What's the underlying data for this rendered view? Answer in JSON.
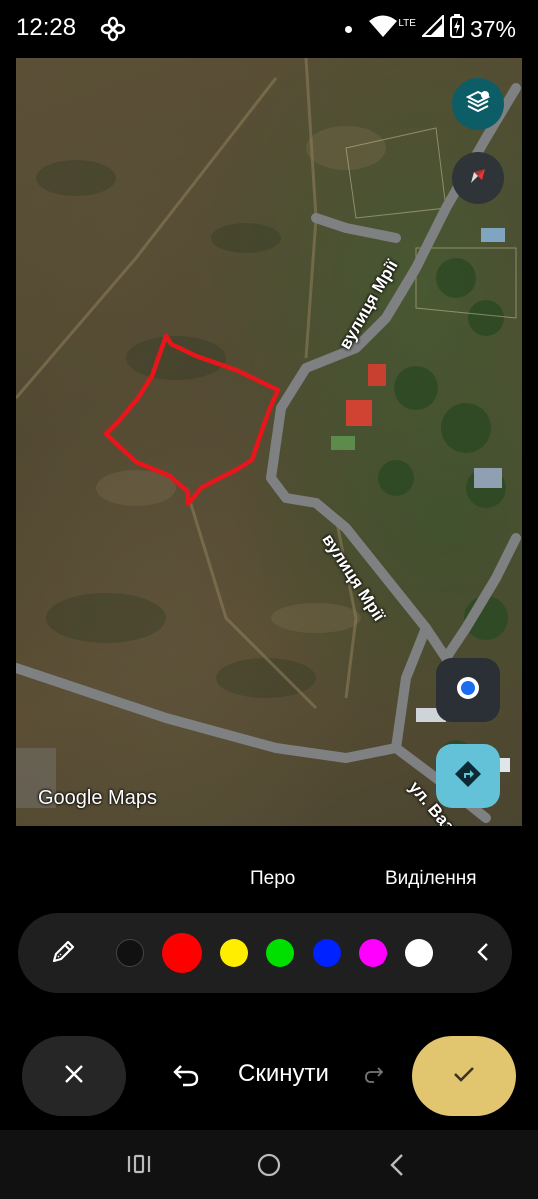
{
  "status_bar": {
    "time": "12:28",
    "network": "LTE",
    "battery": "37%",
    "icons": [
      "fan-icon",
      "dot-icon",
      "wifi-icon",
      "signal-icon",
      "battery-icon"
    ]
  },
  "map": {
    "watermark": "Google Maps",
    "streets": [
      "вулиця Мрії",
      "вулиця Мрії",
      "ул. Вазо"
    ],
    "buttons": [
      "layers-icon",
      "compass-icon",
      "my-location-icon",
      "directions-icon"
    ]
  },
  "toolbar": {
    "pen_label": "Перо",
    "highlight_label": "Виділення",
    "colors": [
      "#111111",
      "#ff0000",
      "#ffee00",
      "#00e000",
      "#0022ff",
      "#ff00ff",
      "#ffffff"
    ],
    "selected_color": "#ff0000"
  },
  "actions": {
    "reset_label": "Скинути"
  },
  "colors": {
    "accent_ok": "#e2c66f",
    "drawing": "#e8161b"
  }
}
